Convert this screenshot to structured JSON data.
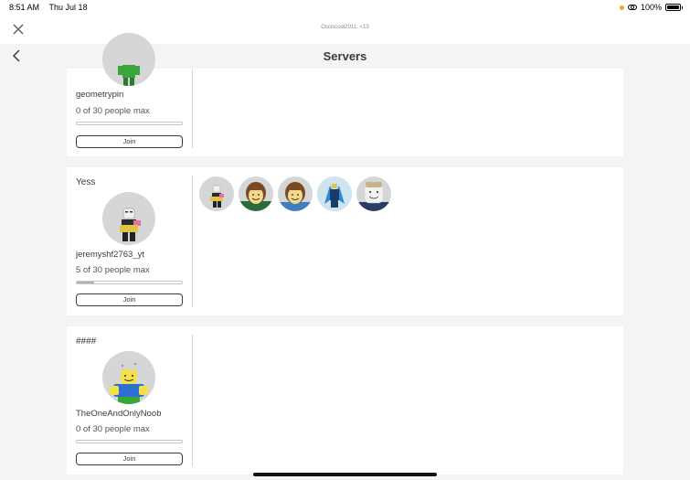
{
  "status_bar": {
    "time": "8:51 AM",
    "date": "Thu Jul 18",
    "battery": "100%"
  },
  "topbar": {
    "account": "Osciscool2011: <13"
  },
  "header": {
    "title": "Servers"
  },
  "servers": [
    {
      "name": "",
      "host": "geometrypin",
      "capacity": "0 of 30 people max",
      "fill_fraction": 0.0,
      "join_label": "Join",
      "avatar_icon": "green-avatar-icon",
      "players": []
    },
    {
      "name": "Yess",
      "host": "jeremyshf2763_yt",
      "capacity": "5 of 30 people max",
      "fill_fraction": 0.1667,
      "join_label": "Join",
      "avatar_icon": "jeremyshf-avatar-icon",
      "players": [
        "player-avatar-1",
        "player-avatar-2",
        "player-avatar-3",
        "player-avatar-4",
        "player-avatar-5"
      ]
    },
    {
      "name": "####",
      "host": "TheOneAndOnlyNoob",
      "capacity": "0 of 30 people max",
      "fill_fraction": 0.0,
      "join_label": "Join",
      "avatar_icon": "noob-avatar-icon",
      "players": []
    }
  ],
  "colors": {
    "background": "#f2f4f5",
    "card": "#ffffff",
    "text": "#393b3d",
    "battery_dot": "#f5a623"
  }
}
